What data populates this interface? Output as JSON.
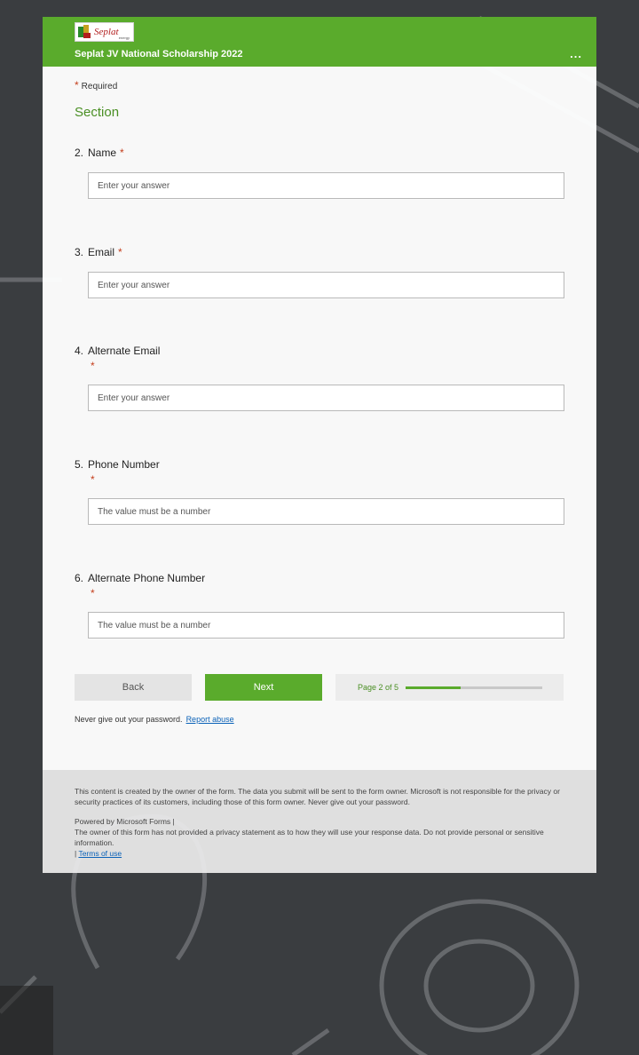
{
  "header": {
    "logo_word": "Seplat",
    "logo_sub": "energy",
    "title": "Seplat JV National Scholarship 2022",
    "more_label": "..."
  },
  "required_label": "Required",
  "section_title": "Section",
  "questions": [
    {
      "num": "2.",
      "label": "Name",
      "placeholder": "Enter your answer"
    },
    {
      "num": "3.",
      "label": "Email",
      "placeholder": "Enter your answer"
    },
    {
      "num": "4.",
      "label": "Alternate Email",
      "placeholder": "Enter your answer"
    },
    {
      "num": "5.",
      "label": "Phone Number",
      "placeholder": "The value must be a number"
    },
    {
      "num": "6.",
      "label": "Alternate Phone Number",
      "placeholder": "The value must be a number"
    }
  ],
  "star": "*",
  "nav": {
    "back_label": "Back",
    "next_label": "Next",
    "page_text": "Page 2 of 5",
    "progress": 0.4
  },
  "warning": {
    "text": "Never give out your password.",
    "report_label": "Report abuse"
  },
  "footer": {
    "disclaimer": "This content is created by the owner of the form. The data you submit will be sent to the form owner. Microsoft is not responsible for the privacy or security practices of its customers, including those of this form owner. Never give out your password.",
    "powered": "Powered by Microsoft Forms |",
    "privacy": "The owner of this form has not provided a privacy statement as to how they will use your response data. Do not provide personal or sensitive information.",
    "terms_prefix": "|",
    "terms_label": "Terms of use"
  },
  "colors": {
    "brand_green": "#5aab2c",
    "required_red": "#c43e1c",
    "link_blue": "#0b62b8"
  }
}
